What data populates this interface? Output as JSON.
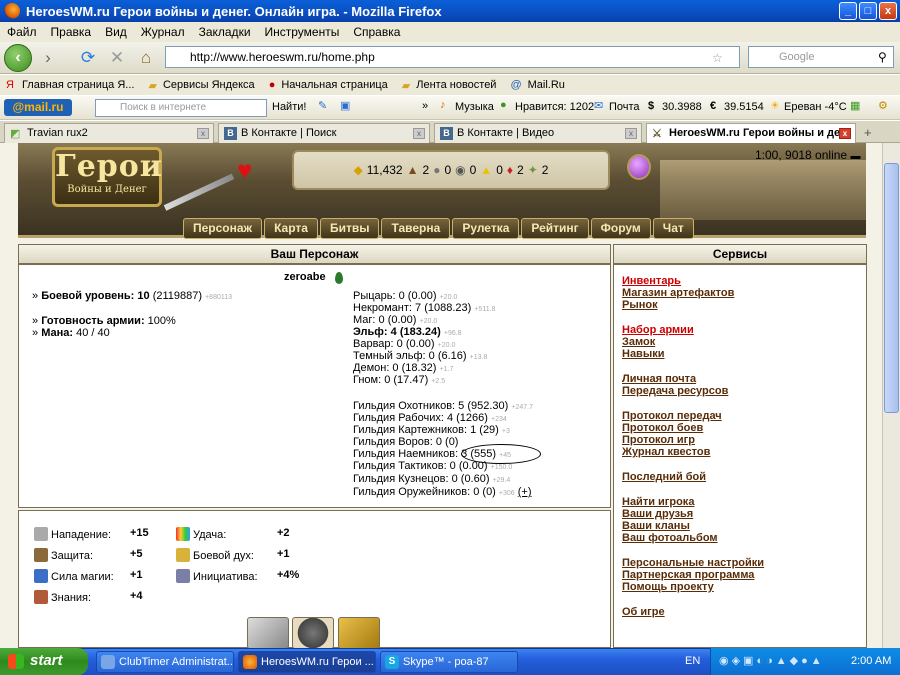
{
  "window": {
    "title": "HeroesWM.ru Герои войны и денег. Онлайн игра. - Mozilla Firefox",
    "min": "_",
    "max": "□",
    "close": "x"
  },
  "menu": [
    "Файл",
    "Правка",
    "Вид",
    "Журнал",
    "Закладки",
    "Инструменты",
    "Справка"
  ],
  "nav": {
    "back": "‹",
    "forward": "›",
    "url": "http://www.heroeswm.ru/home.php",
    "search_placeholder": "Google"
  },
  "bookmarks": [
    "Главная страница Я...",
    "Сервисы Яндекса",
    "Начальная страница",
    "Лента новостей",
    "Mail.Ru"
  ],
  "mailbar": {
    "logo": "@mail.ru",
    "search_placeholder": "Поиск в интернете",
    "find": "Найти!",
    "music": "Музыка",
    "likes": "Нравится: 1202",
    "mail": "Почта",
    "usd": "30.3988",
    "eur": "39.5154",
    "weather": "Ереван -4°C"
  },
  "tabs": [
    {
      "label": "Travian rux2",
      "active": false
    },
    {
      "label": "В Контакте | Поиск",
      "active": false
    },
    {
      "label": "В Контакте | Видео",
      "active": false
    },
    {
      "label": "HeroesWM.ru Герои войны и де...",
      "active": true
    }
  ],
  "game": {
    "logo_big": "Герои",
    "logo_small": "Войны и Денег",
    "online": "1:00, 9018 online",
    "resources": [
      "11,432",
      "2",
      "0",
      "0",
      "0",
      "2",
      "2"
    ],
    "nav": [
      "Персонаж",
      "Карта",
      "Битвы",
      "Таверна",
      "Рулетка",
      "Рейтинг",
      "Форум",
      "Чат"
    ],
    "char_header": "Ваш Персонаж",
    "services_header": "Сервисы",
    "name": "zeroabe",
    "combat_label": "Боевой уровень:",
    "combat_level": "10",
    "combat_exp": "(2119887)",
    "combat_next": "+880113",
    "army_label": "Готовность армии:",
    "army_value": "100%",
    "mana_label": "Мана:",
    "mana_value": "40 / 40",
    "factions": [
      {
        "text": "Рыцарь: 0 (0.00)",
        "next": "+20.0"
      },
      {
        "text": "Некромант: 7 (1088.23)",
        "next": "+511.8"
      },
      {
        "text": "Маг: 0 (0.00)",
        "next": "+20.0"
      },
      {
        "text": "Эльф: 4 (183.24)",
        "next": "+96.8"
      },
      {
        "text": "Варвар: 0 (0.00)",
        "next": "+20.0"
      },
      {
        "text": "Темный эльф: 0 (6.16)",
        "next": "+13.8"
      },
      {
        "text": "Демон: 0 (18.32)",
        "next": "+1.7"
      },
      {
        "text": "Гном: 0 (17.47)",
        "next": "+2.5"
      }
    ],
    "guilds": [
      {
        "text": "Гильдия Охотников: 5 (952.30)",
        "next": "+247.7"
      },
      {
        "text": "Гильдия Рабочих: 4 (1266)",
        "next": "+234"
      },
      {
        "text": "Гильдия Картежников: 1 (29)",
        "next": "+3"
      },
      {
        "text": "Гильдия Воров: 0 (0)",
        "next": ""
      },
      {
        "text": "Гильдия Наемников: 3 (555)",
        "next": "+45"
      },
      {
        "text": "Гильдия Тактиков: 0 (0.00)",
        "next": "+150.0"
      },
      {
        "text": "Гильдия Кузнецов: 0 (0.60)",
        "next": "+29.4"
      },
      {
        "text": "Гильдия Оружейников: 0 (0)",
        "next": "+306"
      }
    ],
    "plus_link": "(+)",
    "stats": [
      {
        "label": "Нападение:",
        "value": "+15"
      },
      {
        "label": "Защита:",
        "value": "+5"
      },
      {
        "label": "Сила магии:",
        "value": "+1"
      },
      {
        "label": "Знания:",
        "value": "+4"
      },
      {
        "label": "Удача:",
        "value": "+2"
      },
      {
        "label": "Боевой дух:",
        "value": "+1"
      },
      {
        "label": "Инициатива:",
        "value": "+4%"
      }
    ],
    "services": [
      "Инвентарь",
      "Магазин артефактов",
      "Рынок",
      "Набор армии",
      "Замок",
      "Навыки",
      "Личная почта",
      "Передача ресурсов",
      "Протокол передач",
      "Протокол боев",
      "Протокол игр",
      "Журнал квестов",
      "Последний бой",
      "Найти игрока",
      "Ваши друзья",
      "Ваши кланы",
      "Ваш фотоальбом",
      "Персональные настройки",
      "Партнерская программа",
      "Помощь проекту",
      "Об игре"
    ]
  },
  "taskbar": {
    "start": "start",
    "tasks": [
      "ClubTimer Administrat...",
      "HeroesWM.ru Герои ...",
      "Skype™ - poa-87"
    ],
    "lang": "EN",
    "clock": "2:00 AM"
  },
  "colors": {
    "accent": "#c00000",
    "link": "#592c08",
    "xp_blue": "#245edb"
  }
}
